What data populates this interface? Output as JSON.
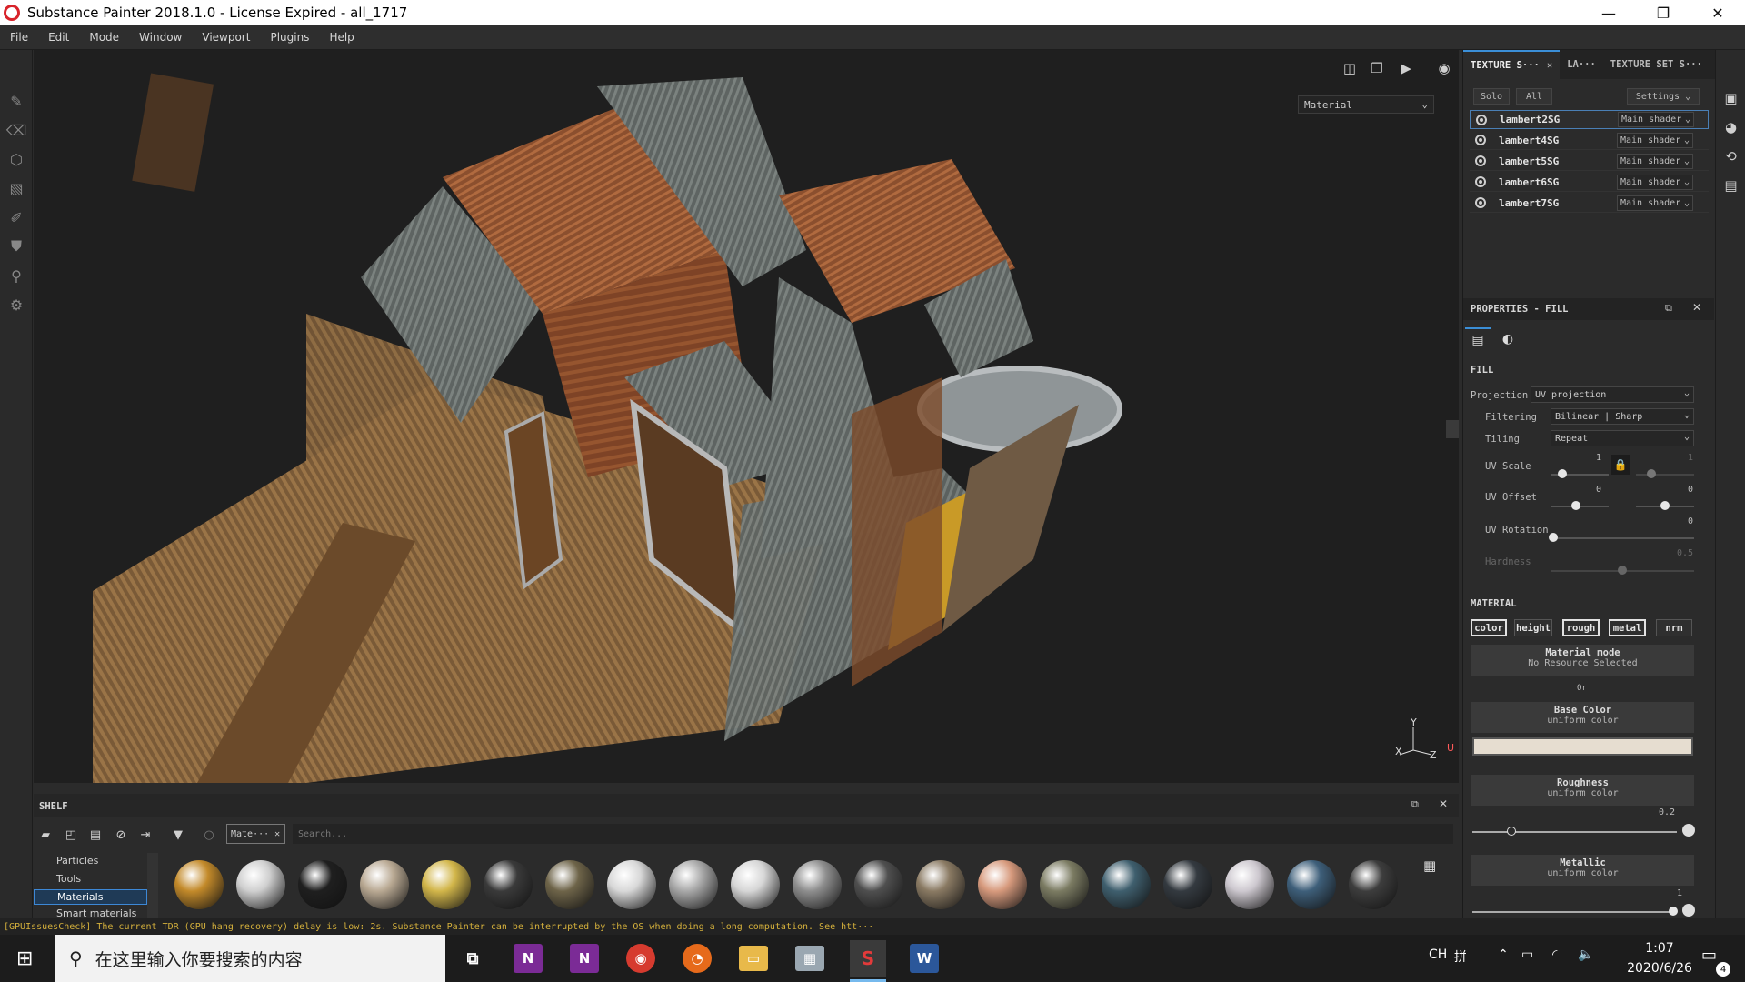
{
  "window": {
    "title": "Substance Painter 2018.1.0 - License Expired - all_1717",
    "minimize": "—",
    "maximize": "❐",
    "close": "✕"
  },
  "menu": [
    "File",
    "Edit",
    "Mode",
    "Window",
    "Viewport",
    "Plugins",
    "Help"
  ],
  "viewport": {
    "mode_dropdown": "Material",
    "axis_labels": {
      "y": "Y",
      "x": "X",
      "z": "Z",
      "u": "U"
    }
  },
  "texture_set_panel": {
    "tabs": [
      "TEXTURE S···",
      "LA···",
      "TEXTURE SET S···"
    ],
    "solo_label": "Solo",
    "all_label": "All",
    "settings_label": "Settings",
    "rows": [
      {
        "name": "lambert2SG",
        "shader": "Main shader"
      },
      {
        "name": "lambert4SG",
        "shader": "Main shader"
      },
      {
        "name": "lambert5SG",
        "shader": "Main shader"
      },
      {
        "name": "lambert6SG",
        "shader": "Main shader"
      },
      {
        "name": "lambert7SG",
        "shader": "Main shader"
      }
    ]
  },
  "properties": {
    "header": "PROPERTIES - FILL",
    "fill_label": "FILL",
    "projection_label": "Projection",
    "projection_value": "UV projection",
    "filtering_label": "Filtering",
    "filtering_value": "Bilinear | Sharp",
    "tiling_label": "Tiling",
    "tiling_value": "Repeat",
    "uv_scale_label": "UV Scale",
    "uv_scale_value_1": "1",
    "uv_scale_value_2": "1",
    "uv_offset_label": "UV Offset",
    "uv_offset_value_1": "0",
    "uv_offset_value_2": "0",
    "uv_rotation_label": "UV Rotation",
    "uv_rotation_value": "0",
    "hardness_label": "Hardness",
    "hardness_value": "0.5",
    "material_label": "MATERIAL",
    "channels": [
      "color",
      "height",
      "rough",
      "metal",
      "nrm"
    ],
    "material_mode_label": "Material mode",
    "material_mode_sub": "No Resource Selected",
    "or_label": "Or",
    "base_color_label": "Base Color",
    "base_color_sub": "uniform color",
    "base_color_swatch": "#e6ddd0",
    "roughness_label": "Roughness",
    "roughness_sub": "uniform color",
    "roughness_value": "0.2",
    "metallic_label": "Metallic",
    "metallic_sub": "uniform color",
    "metallic_value": "1"
  },
  "shelf": {
    "title": "SHELF",
    "filter_tag": "Mate···",
    "search_placeholder": "Search...",
    "categories": [
      "Particles",
      "Tools",
      "Materials",
      "Smart materials"
    ],
    "material_colors": [
      "#c38a2a",
      "#cfcfcf",
      "#1f1f1f",
      "#b9a993",
      "#d2b64a",
      "#3a3a3a",
      "#6e6449",
      "#d8d8d8",
      "#a8a8a8",
      "#d6d6d6",
      "#8e8e8e",
      "#4f4f4f",
      "#8a7a63",
      "#d79a7d",
      "#7b7b62",
      "#3f5f6e",
      "#343a40",
      "#cdc8cf",
      "#3e5f7a",
      "#3d3d3d"
    ]
  },
  "log": "[GPUIssuesCheck] The current TDR (GPU hang recovery) delay is low: 2s. Substance Painter can be interrupted by the OS when doing a long computation. See htt···",
  "taskbar": {
    "search_placeholder": "在这里输入你要搜索的内容",
    "time": "1:07",
    "date": "2020/6/26",
    "ime": "CH",
    "ime2": "拼",
    "notifications": "4"
  }
}
